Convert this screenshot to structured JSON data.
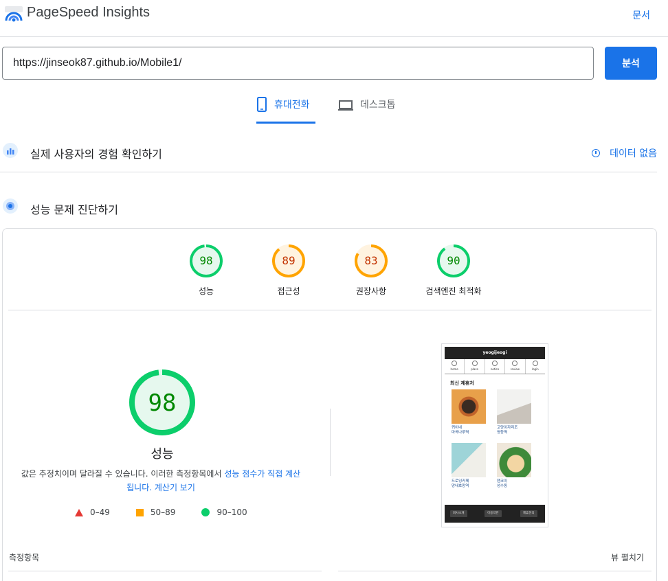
{
  "header": {
    "title": "PageSpeed Insights",
    "docs_label": "문서"
  },
  "search": {
    "url_value": "https://jinseok87.github.io/Mobile1/",
    "analyze_label": "분석"
  },
  "tabs": [
    {
      "label": "휴대전화",
      "active": true,
      "icon": "smartphone-icon"
    },
    {
      "label": "데스크톱",
      "active": false,
      "icon": "laptop-icon"
    }
  ],
  "field_data": {
    "title": "실제 사용자의 경험 확인하기",
    "status": "데이터 없음"
  },
  "lab_data": {
    "title": "성능 문제 진단하기"
  },
  "scores": [
    {
      "label": "성능",
      "value": "98",
      "score": 98,
      "color": "#0cce6b",
      "fill": "#e6f8ee",
      "text": "#008800"
    },
    {
      "label": "접근성",
      "value": "89",
      "score": 89,
      "color": "#ffa400",
      "fill": "#fff3e0",
      "text": "#c33300"
    },
    {
      "label": "권장사항",
      "value": "83",
      "score": 83,
      "color": "#ffa400",
      "fill": "#fff3e0",
      "text": "#c33300"
    },
    {
      "label": "검색엔진 최적화",
      "value": "90",
      "score": 90,
      "color": "#0cce6b",
      "fill": "#e6f8ee",
      "text": "#008800"
    }
  ],
  "main_score": {
    "value": "98",
    "score": 98,
    "label": "성능"
  },
  "description": {
    "prefix": "값은 추정치이며 달라질 수 있습니다. 이러한 측정항목에서 ",
    "link1": "성능 점수가 직접 계산됩니다.",
    "link2": "계산기 보기"
  },
  "legend": [
    {
      "range": "0–49",
      "color": "#e53935"
    },
    {
      "range": "50–89",
      "color": "#ffa400"
    },
    {
      "range": "90–100",
      "color": "#0cce6b"
    }
  ],
  "preview": {
    "site_title": "yeogijeogi",
    "nav": [
      "home",
      "place",
      "notice",
      "review",
      "login"
    ],
    "section_title": "최신 제휴처",
    "items": [
      {
        "line1": "퀴이네",
        "line2": "마곡나루역"
      },
      {
        "line1": "고양이자리조",
        "line2": "영등역"
      },
      {
        "line1": "드로잉카페",
        "line2": "망내호망역"
      },
      {
        "line1": "팬코이",
        "line2": "성수동"
      }
    ],
    "footer": [
      "회사소개",
      "이용약관",
      "제휴문의"
    ]
  },
  "metrics": {
    "label": "측정항목",
    "expand_label": "뷰 펼치기"
  }
}
